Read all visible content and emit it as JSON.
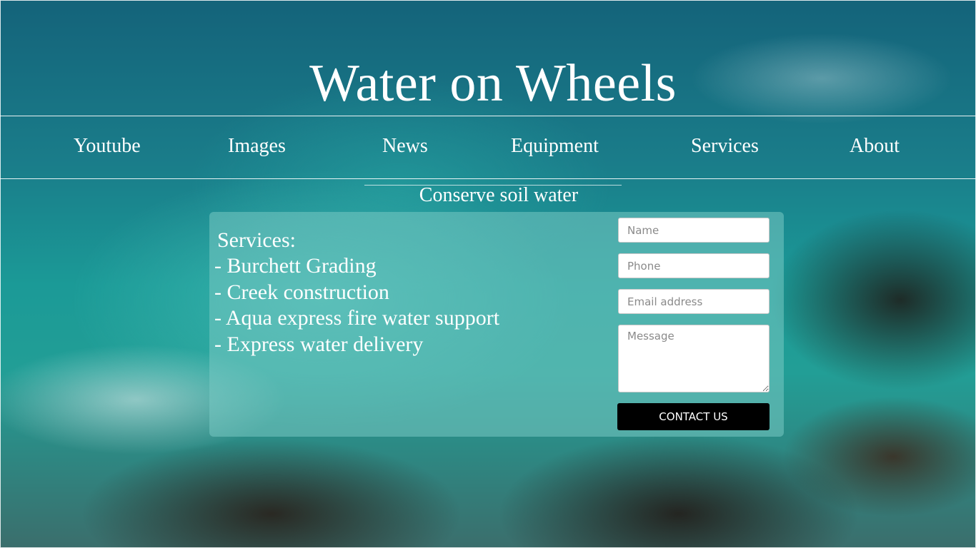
{
  "header": {
    "title": "Water on Wheels"
  },
  "nav": {
    "items": [
      {
        "label": "Youtube"
      },
      {
        "label": "Images"
      },
      {
        "label": "News"
      },
      {
        "label": "Equipment"
      },
      {
        "label": "Services"
      },
      {
        "label": "About"
      }
    ]
  },
  "tagline": "Conserve soil water",
  "services": {
    "heading": "Services:",
    "items": [
      "- Burchett Grading",
      "- Creek construction",
      "- Aqua express fire water support",
      "- Express water delivery"
    ]
  },
  "contact_form": {
    "name_placeholder": "Name",
    "phone_placeholder": "Phone",
    "email_placeholder": "Email address",
    "message_placeholder": "Message",
    "submit_label": "CONTACT US"
  }
}
